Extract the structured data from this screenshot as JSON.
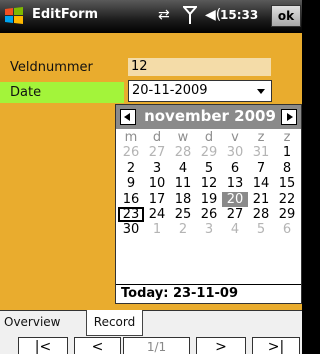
{
  "titlebar": {
    "app_title": "EditForm",
    "time": "15:33",
    "ok_label": "ok",
    "icons": [
      "windows-logo-icon",
      "connectivity-icon",
      "signal-icon",
      "volume-icon"
    ]
  },
  "form": {
    "fields": [
      {
        "label": "Veldnummer",
        "value": "12"
      },
      {
        "label": "Date",
        "value": "20-11-2009"
      }
    ]
  },
  "calendar": {
    "month_label": "november 2009",
    "weekdays": [
      "m",
      "d",
      "w",
      "d",
      "v",
      "z",
      "z"
    ],
    "weeks": [
      [
        "26",
        "27",
        "28",
        "29",
        "30",
        "31",
        "1"
      ],
      [
        "2",
        "3",
        "4",
        "5",
        "6",
        "7",
        "8"
      ],
      [
        "9",
        "10",
        "11",
        "12",
        "13",
        "14",
        "15"
      ],
      [
        "16",
        "17",
        "18",
        "19",
        "20",
        "21",
        "22"
      ],
      [
        "23",
        "24",
        "25",
        "26",
        "27",
        "28",
        "29"
      ],
      [
        "30",
        "1",
        "2",
        "3",
        "4",
        "5",
        "6"
      ]
    ],
    "selected_day": "20",
    "today_day": "23",
    "today_label": "Today: 23-11-09"
  },
  "tabs": [
    {
      "label": "Overview",
      "active": false
    },
    {
      "label": "Record",
      "active": true
    }
  ],
  "navigator": {
    "first": "|<",
    "prev": "<",
    "position": "1/1",
    "next": ">",
    "last": ">|"
  },
  "colors": {
    "form_background": "#e9ac2e",
    "date_label_highlight": "#a3f43a",
    "field_background": "#f4dca8",
    "calendar_header": "#8a8a8a"
  }
}
